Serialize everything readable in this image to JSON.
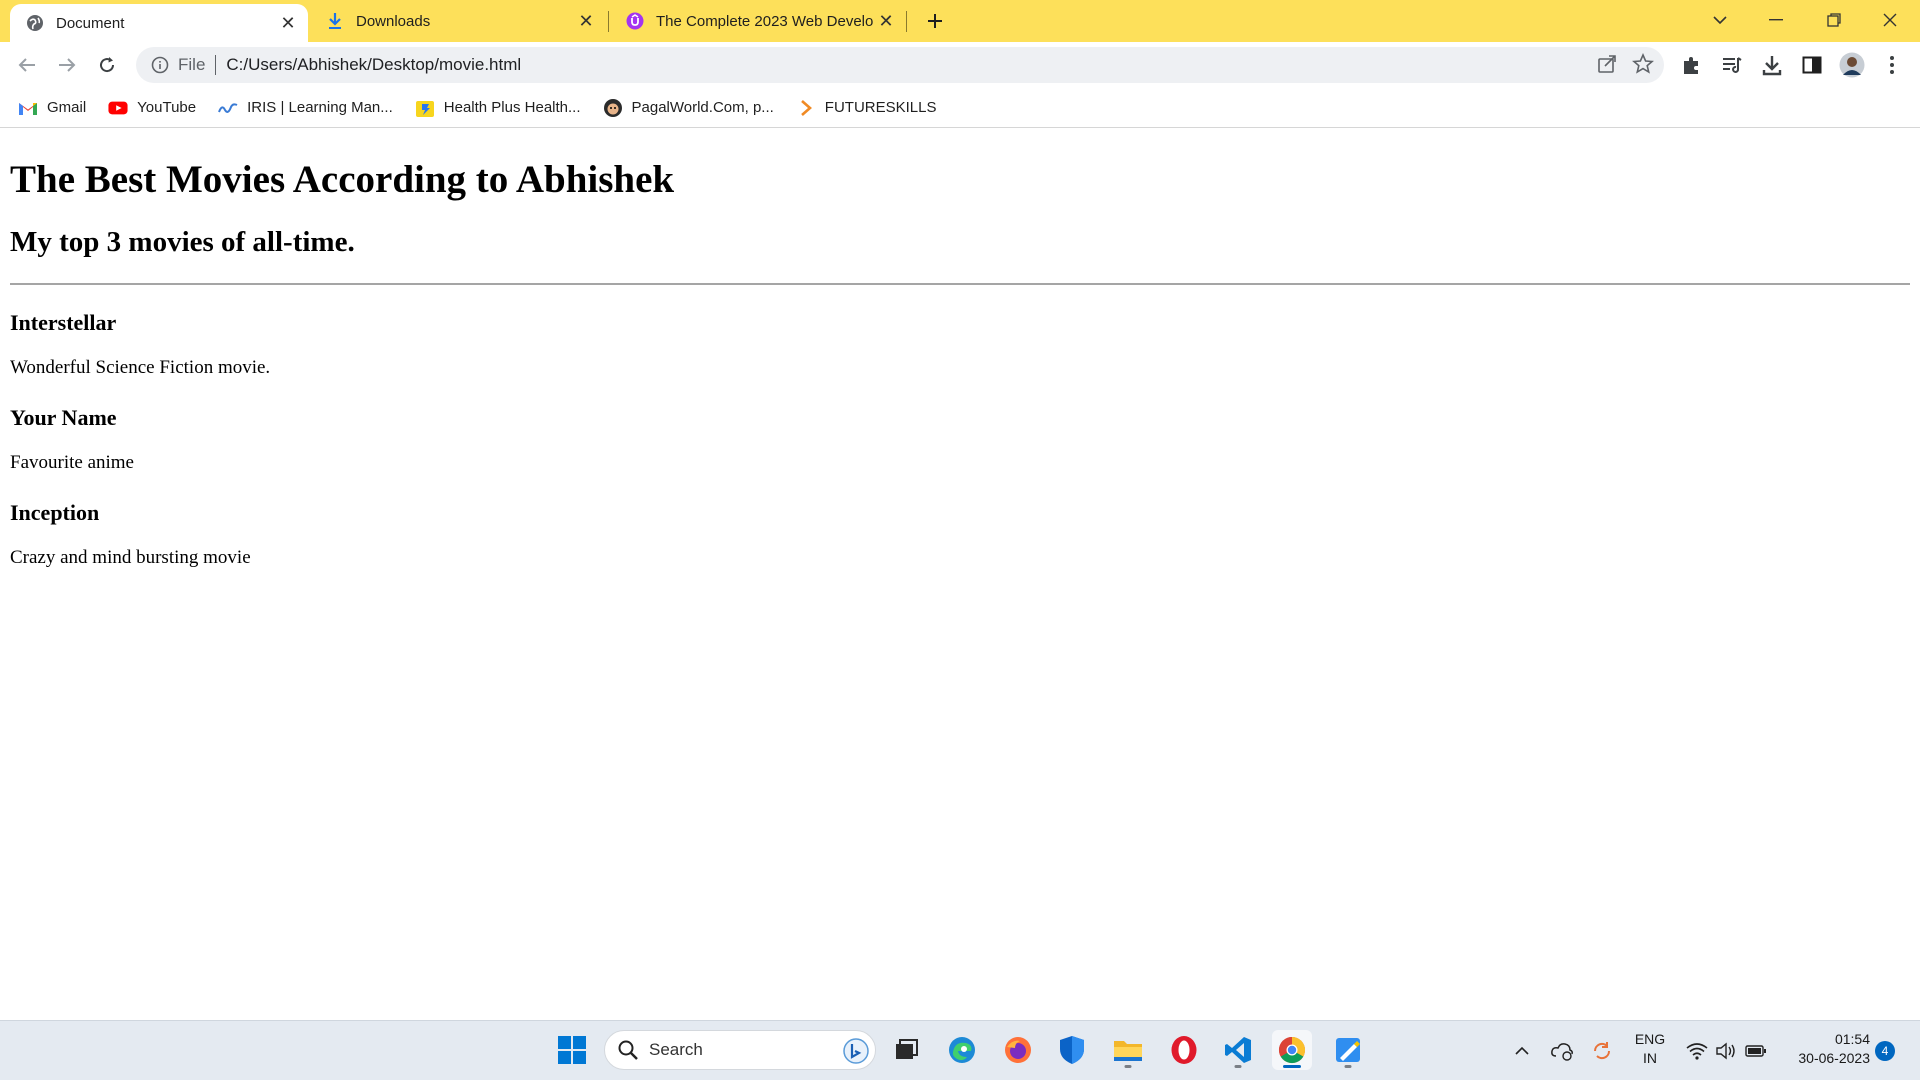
{
  "browser": {
    "tabs": [
      {
        "label": "Document",
        "icon": "globe-icon",
        "active": true
      },
      {
        "label": "Downloads",
        "icon": "download-icon",
        "active": false
      },
      {
        "label": "The Complete 2023 Web Develop",
        "icon": "udemy-icon",
        "active": false
      }
    ],
    "address": {
      "scheme": "File",
      "url": "C:/Users/Abhishek/Desktop/movie.html"
    },
    "bookmarks": [
      {
        "label": "Gmail",
        "icon": "gmail-icon"
      },
      {
        "label": "YouTube",
        "icon": "youtube-icon"
      },
      {
        "label": "IRIS | Learning Man...",
        "icon": "iris-icon"
      },
      {
        "label": "Health Plus Health...",
        "icon": "flipkart-icon"
      },
      {
        "label": "PagalWorld.Com, p...",
        "icon": "pagalworld-icon"
      },
      {
        "label": "FUTURESKILLS",
        "icon": "chevron-right-icon"
      }
    ],
    "accent_color": "#fde05a"
  },
  "page": {
    "heading": "The Best Movies According to Abhishek",
    "subheading": "My top 3 movies of all-time.",
    "movies": [
      {
        "title": "Interstellar",
        "description": "Wonderful Science Fiction movie."
      },
      {
        "title": "Your Name",
        "description": "Favourite anime"
      },
      {
        "title": "Inception",
        "description": "Crazy and mind bursting movie"
      }
    ]
  },
  "taskbar": {
    "search_label": "Search",
    "language": {
      "line1": "ENG",
      "line2": "IN"
    },
    "clock": {
      "time": "01:54",
      "date": "30-06-2023"
    },
    "notification_count": "4"
  }
}
